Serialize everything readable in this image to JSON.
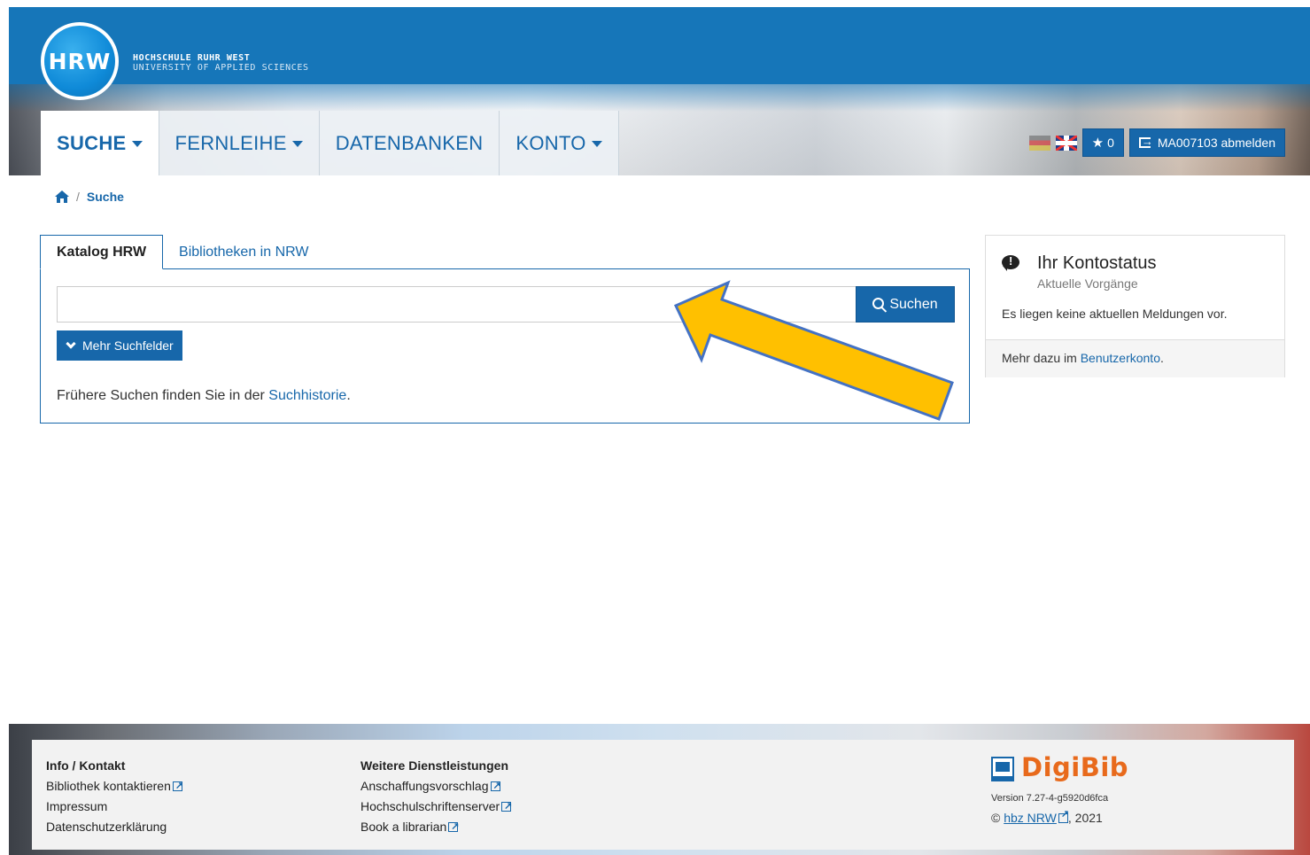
{
  "brand": {
    "logo_text": "HRW",
    "line1": "HOCHSCHULE RUHR WEST",
    "line2": "UNIVERSITY OF APPLIED SCIENCES"
  },
  "nav": {
    "items": [
      {
        "label": "SUCHE",
        "dropdown": true,
        "active": true
      },
      {
        "label": "FERNLEIHE",
        "dropdown": true,
        "active": false
      },
      {
        "label": "DATENBANKEN",
        "dropdown": false,
        "active": false
      },
      {
        "label": "KONTO",
        "dropdown": true,
        "active": false
      }
    ]
  },
  "toolbar": {
    "favorites_count": "0",
    "logout_label": "MA007103 abmelden"
  },
  "breadcrumb": {
    "separator": "/",
    "current": "Suche"
  },
  "search": {
    "tabs": [
      "Katalog HRW",
      "Bibliotheken in NRW"
    ],
    "input_value": "",
    "button_label": "Suchen",
    "more_fields_label": "Mehr Suchfelder",
    "history_prefix": "Frühere Suchen finden Sie in der ",
    "history_link": "Suchhistorie",
    "history_suffix": "."
  },
  "account_status": {
    "title": "Ihr Kontostatus",
    "subtitle": "Aktuelle Vorgänge",
    "message": "Es liegen keine aktuellen Meldungen vor.",
    "footer_prefix": "Mehr dazu im ",
    "footer_link": "Benutzerkonto",
    "footer_suffix": "."
  },
  "footer": {
    "col1": {
      "heading": "Info / Kontakt",
      "links": [
        "Bibliothek kontaktieren",
        "Impressum",
        "Datenschutzerklärung"
      ]
    },
    "col2": {
      "heading": "Weitere Dienstleistungen",
      "links": [
        "Anschaffungsvorschlag",
        "Hochschulschriftenserver",
        "Book a librarian"
      ]
    },
    "digibib": {
      "name": "DigiBib",
      "version": "Version 7.27-4-g5920d6fca",
      "copyright_prefix": "© ",
      "copyright_link": "hbz NRW",
      "copyright_suffix": ", 2021"
    }
  },
  "colors": {
    "primary": "#1767aa",
    "header_blue": "#1676b9",
    "arrow_fill": "#ffc000",
    "arrow_stroke": "#4472c4",
    "digibib_orange": "#e86a1c"
  }
}
